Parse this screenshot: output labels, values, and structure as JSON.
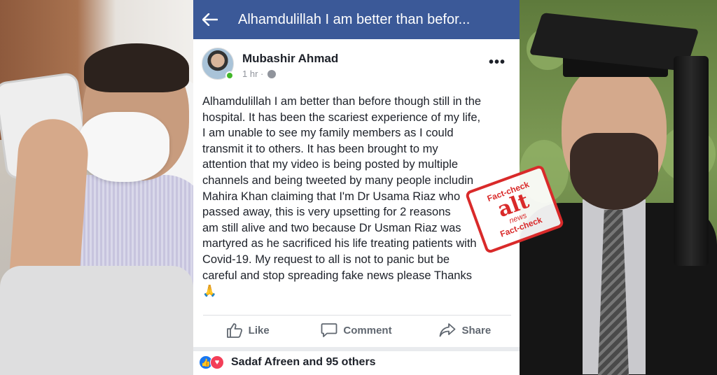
{
  "header": {
    "title": "Alhamdulillah I am better than befor..."
  },
  "post": {
    "author": "Mubashir Ahmad",
    "time": "1 hr ·",
    "body_lines": [
      "Alhamdulillah I am better than before though still in the",
      "hospital. It has been the scariest experience of my life,",
      "I am unable to see my family members as I could",
      "transmit it to others. It has been brought to my",
      "attention that my video is being posted by multiple",
      "channels and being tweeted by many people includin",
      "Mahira Khan claiming that I'm Dr Usama Riaz who",
      "passed away, this is very upsetting for 2 reasons",
      "am still alive and two because Dr Usman Riaz was",
      "martyred as he sacrificed his life treating patients with",
      "Covid-19. My request to all is not to panic but be",
      "careful and stop spreading fake news please Thanks"
    ],
    "emoji": "🙏"
  },
  "actions": {
    "like": "Like",
    "comment": "Comment",
    "share": "Share"
  },
  "reactions": {
    "text": "Sadaf Afreen and 95 others"
  },
  "stamp": {
    "top": "Fact-check",
    "logo": "alt",
    "news": "news",
    "bottom": "Fact-check"
  },
  "colors": {
    "fb_blue": "#3b5998",
    "stamp_red": "#d92a2a"
  }
}
